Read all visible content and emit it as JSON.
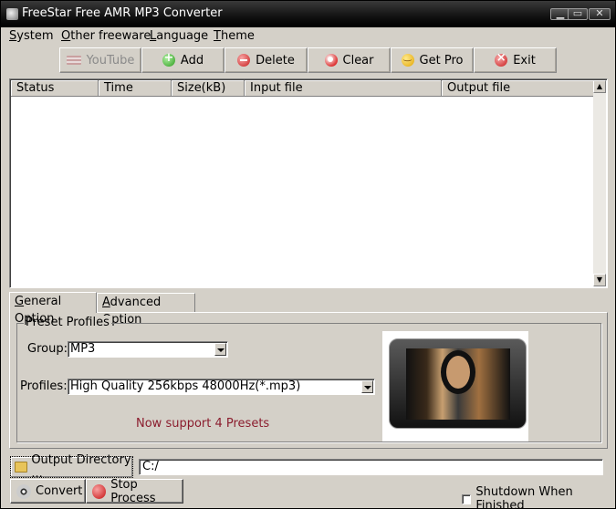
{
  "window": {
    "title": "FreeStar Free AMR MP3 Converter"
  },
  "menu": [
    {
      "underline": "S",
      "rest": "ystem"
    },
    {
      "underline": "O",
      "rest": "ther freeware"
    },
    {
      "underline": "L",
      "rest": "anguage"
    },
    {
      "underline": "T",
      "rest": "heme"
    }
  ],
  "toolbar": {
    "youtube": "YouTube",
    "add": "Add",
    "delete": "Delete",
    "clear": "Clear",
    "get_pro": "Get Pro",
    "exit": "Exit"
  },
  "list": {
    "columns": [
      "Status",
      "Time",
      "Size(kB)",
      "Input file",
      "Output file"
    ],
    "rows": []
  },
  "tabs": [
    {
      "underline": "G",
      "rest": "eneral Option",
      "active": true
    },
    {
      "underline": "A",
      "rest": "dvanced Option",
      "active": false
    }
  ],
  "preset": {
    "group_title": "Preset Profiles",
    "group_label": "Group:",
    "group_value": "MP3",
    "profiles_label": "Profiles:",
    "profiles_value": "High Quality 256kbps 48000Hz(*.mp3)",
    "support_text": "Now support 4 Presets",
    "support_color": "#8b1d2e"
  },
  "output": {
    "button_label": "Output Directory ...",
    "path": "C:/"
  },
  "actions": {
    "convert": "Convert",
    "stop": "Stop Process",
    "shutdown_label": "Shutdown When Finished",
    "shutdown_checked": false
  },
  "icons": {
    "youtube": "youtube-icon",
    "add": "add-icon",
    "delete": "delete-icon",
    "clear": "clear-icon",
    "get_pro": "smiley-icon",
    "exit": "exit-icon",
    "folder": "folder-icon",
    "convert": "film-reel-icon",
    "stop": "stop-icon"
  }
}
